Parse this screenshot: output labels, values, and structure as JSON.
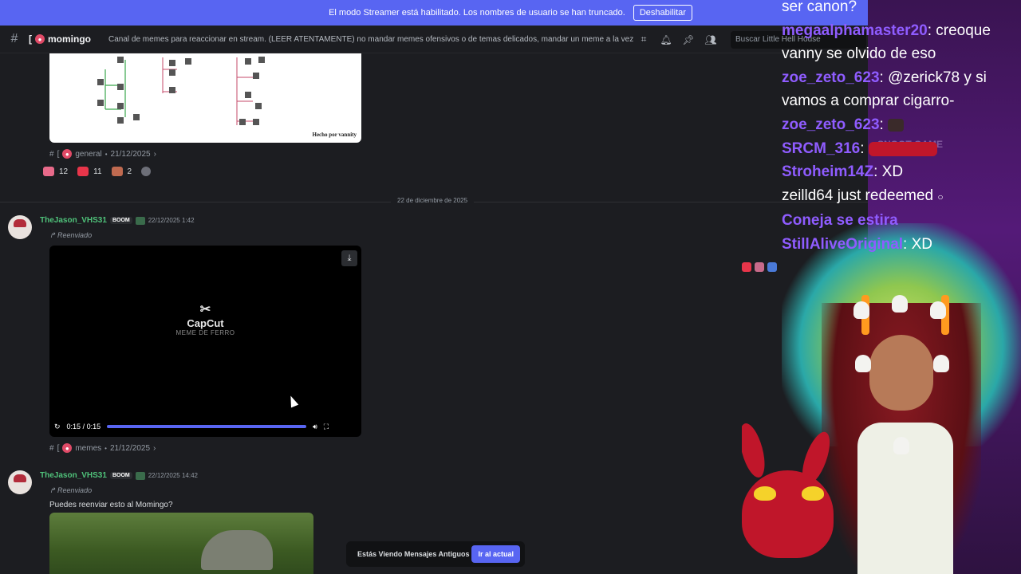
{
  "banner": {
    "text": "El modo Streamer está habilitado. Los nombres de usuario se han truncado.",
    "button": "Deshabilitar"
  },
  "header": {
    "channel_name": "momingo",
    "channel_prefix": "[",
    "topic": "Canal de memes para reaccionar en stream. (LEER ATENTAMENTE) no mandar memes ofensivos o de temas delicados, mandar un meme a la vez , ver qu...",
    "search_placeholder": "Buscar Little Hell House"
  },
  "messages": {
    "first_forward": {
      "image_credit": "Hecho por vannity",
      "source": "[ ",
      "channel": "general",
      "date": "21/12/2025",
      "reactions": [
        {
          "icon": "skull-reaction-icon",
          "count": "12",
          "color": "#e86a8a"
        },
        {
          "icon": "heart-reaction-icon",
          "count": "11",
          "color": "#e8354a"
        },
        {
          "icon": "chair-reaction-icon",
          "count": "2",
          "color": "#c06a50"
        }
      ]
    },
    "date_divider": "22 de diciembre de 2025",
    "video_msg": {
      "author": "TheJason_VHS31",
      "tag": "BOOM",
      "timestamp": "22/12/2025 1:42",
      "forwarded": "Reenviado",
      "video_brand": "CapCut",
      "video_sub": "MEME DE FERRO",
      "time": "0:15 / 0:15",
      "source_channel": "memes",
      "source_date": "21/12/2025"
    },
    "text_msg": {
      "author": "TheJason_VHS31",
      "tag": "BOOM",
      "timestamp": "22/12/2025 14:42",
      "forwarded": "Reenviado",
      "text": "Puedes reenviar esto al Momingo?"
    }
  },
  "jump_bar": {
    "label": "Estás Viendo Mensajes Antiguos",
    "button": "Ir al actual"
  },
  "stream_chat": [
    {
      "name": "",
      "text": "ser canon?"
    },
    {
      "name": "megaalphamaster20",
      "text": ": creoque vanny se olvido de eso"
    },
    {
      "name": "zoe_zeto_623",
      "text": ": @zerick78 y si vamos a comprar cigarro-"
    },
    {
      "name": "zoe_zeto_623",
      "text": ":"
    },
    {
      "name": "SRCM_316",
      "text": ":"
    },
    {
      "name": "Stroheim14Z",
      "text": ": XD"
    },
    {
      "name": "",
      "text": "zeilld64 just redeemed"
    },
    {
      "name": "Coneja se estira",
      "text": ""
    },
    {
      "name": "StillAliveOriginal",
      "text": ": XD"
    }
  ],
  "overlay_text": "SNOOT GAME",
  "colors": {
    "banner": "#5865f2",
    "accent": "#5865f2",
    "author": "#4fc27a",
    "chat_name": "#8f5cff"
  }
}
